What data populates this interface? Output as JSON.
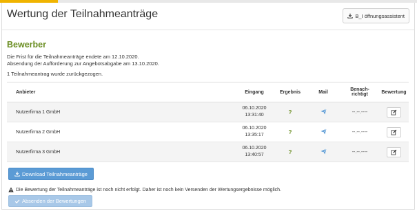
{
  "header": {
    "title": "Wertung der Teilnahmeanträge",
    "assist_label": "B_I öffnungsassistent"
  },
  "section": {
    "title": "Bewerber",
    "deadline_text": "Die Frist für die Teilnahmeanträge endete am 12.10.2020.",
    "invite_text": "Absendung der Aufforderung zur Angebotsabgabe am 13.10.2020.",
    "withdrawn_text": "1 Teilnahmeantrag wurde zurückgezogen."
  },
  "table": {
    "headers": {
      "anbieter": "Anbieter",
      "eingang": "Eingang",
      "ergebnis": "Ergebnis",
      "mail": "Mail",
      "benach_1": "Benach-",
      "benach_2": "richtigt",
      "bewertung": "Bewertung"
    },
    "rows": [
      {
        "anbieter": "Nutzerfirma 1 GmbH",
        "date": "06.10.2020",
        "time": "13:31:40",
        "ergebnis": "?",
        "benachrichtigt": "--.--.----"
      },
      {
        "anbieter": "Nutzerfirma 2 GmbH",
        "date": "06.10.2020",
        "time": "13:35:17",
        "ergebnis": "?",
        "benachrichtigt": "--.--.----"
      },
      {
        "anbieter": "Nutzerfirma 3 GmbH",
        "date": "06.10.2020",
        "time": "13:40:57",
        "ergebnis": "?",
        "benachrichtigt": "--.--.----"
      }
    ]
  },
  "actions": {
    "download_label": "Download Teilnahmeanträge",
    "warning_text": "Die Bewertung der Teilnahmeanträge ist noch nicht erfolgt. Daher ist noch kein Versenden der Wertungsergebnisse möglich.",
    "send_label": "Absenden der Bewertungen"
  },
  "icons": {
    "assist": "download-icon",
    "mail": "paper-plane-icon",
    "edit": "edit-icon",
    "download": "download-icon",
    "warning": "warning-icon",
    "send": "check-icon"
  },
  "colors": {
    "accent": "#f0b400",
    "section_title": "#6b8e23",
    "primary_button": "#5b9bd5",
    "disabled_button": "#a8c8e8",
    "mail_icon": "#5b9bd5"
  }
}
